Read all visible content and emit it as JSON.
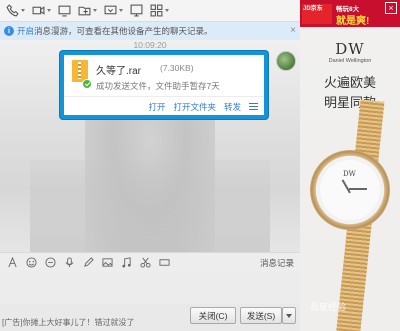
{
  "toolbar": {
    "icons": [
      "phone-icon",
      "video-icon",
      "screen-share-icon",
      "folder-icon",
      "remote-icon",
      "whiteboard-icon",
      "apps-icon"
    ]
  },
  "notice": {
    "prefix": "开启",
    "text": "消息漫游，可查看在其他设备产生的聊天记录。",
    "close": "×"
  },
  "chat": {
    "timestamp": "10:09:20",
    "file": {
      "name": "久等了.rar",
      "size": "(7.30KB)",
      "status": "成功发送文件，文件助手暂存7天",
      "actions": {
        "open": "打开",
        "open_folder": "打开文件夹",
        "forward": "转发"
      }
    }
  },
  "inputbar": {
    "icons": [
      "font-icon",
      "emoji-icon",
      "vip-emoji-icon",
      "voice-icon",
      "edit-icon",
      "image-icon",
      "music-icon",
      "scissors-icon",
      "more-icon"
    ],
    "history": "消息记录"
  },
  "footer": {
    "ad_text": "[广告]你摊上大好事儿了！错过就没了",
    "close_btn": "关闭(C)",
    "send_btn": "发送(S)"
  },
  "ad": {
    "jd_logo": "JD京东",
    "jd_slogan_small": "畅玩8大",
    "jd_slogan_big": "就是爽!",
    "brand_logo": "DW",
    "brand_name": "Daniel Wellington",
    "slogan_line1": "火遍欧美",
    "slogan_line2": "明星同款",
    "watch_logo": "DW",
    "close": "×"
  },
  "watermark": "百度经验",
  "colors": {
    "accent_blue": "#1494d8",
    "link_blue": "#2f7cd0",
    "success_green": "#4db53c",
    "jd_red": "#c8102e"
  }
}
